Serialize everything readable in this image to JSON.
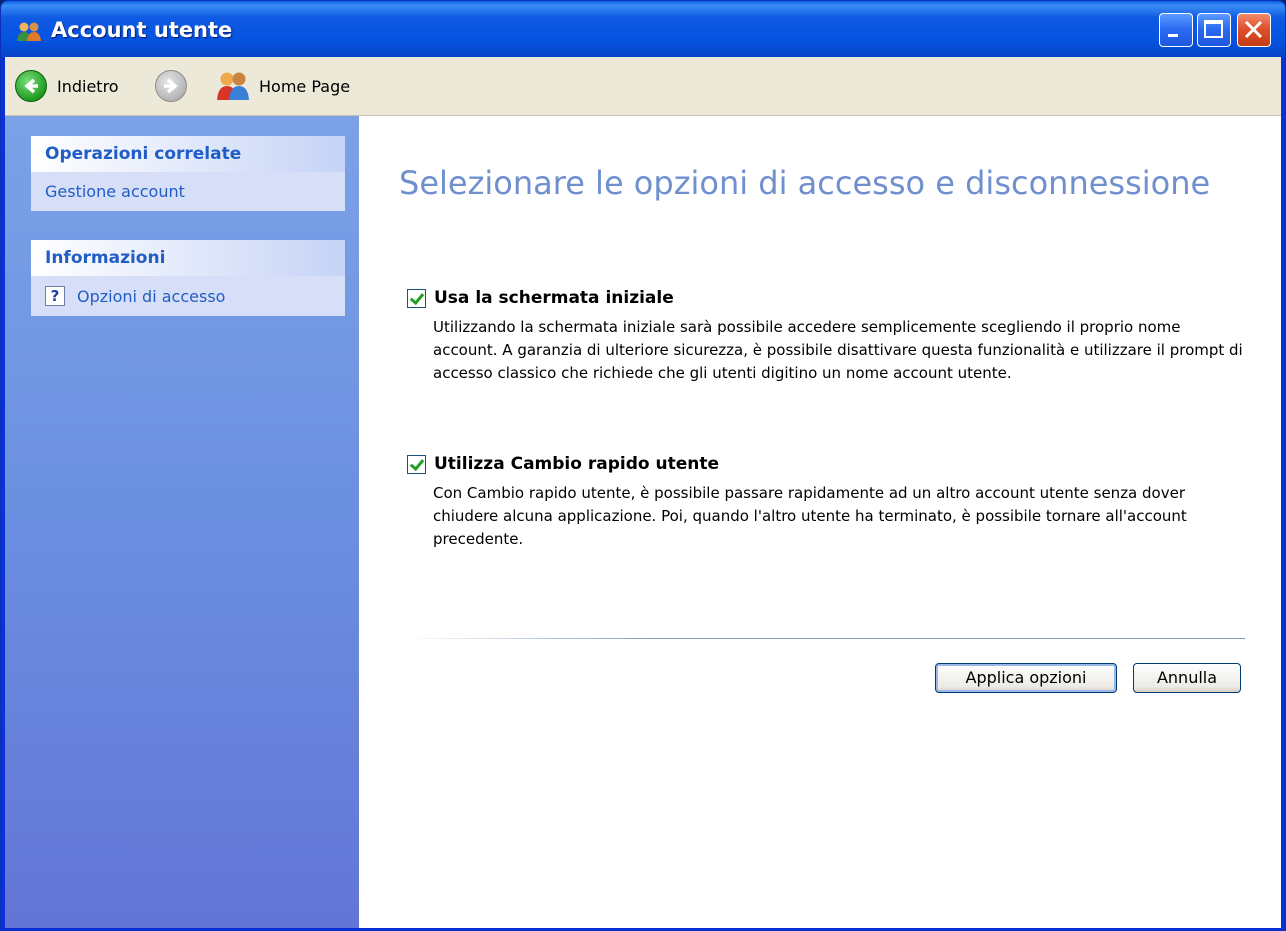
{
  "window": {
    "title": "Account utente",
    "colors": {
      "titlebar": "#0553e0",
      "sidebar": "#6b8fe0",
      "heading": "#6f8fcf",
      "link": "#215dc6"
    }
  },
  "titlebar": {
    "icons": [
      "users-icon",
      "minimize-icon",
      "maximize-icon",
      "close-icon"
    ]
  },
  "toolbar": {
    "back_label": "Indietro",
    "home_label": "Home Page"
  },
  "sidebar": {
    "panels": [
      {
        "title": "Operazioni correlate",
        "links": [
          {
            "label": "Gestione account"
          }
        ]
      },
      {
        "title": "Informazioni",
        "links": [
          {
            "label": "Opzioni di accesso",
            "icon": "help-icon"
          }
        ]
      }
    ]
  },
  "main": {
    "heading": "Selezionare le opzioni di accesso e disconnessione",
    "options": [
      {
        "label": "Usa la schermata iniziale",
        "checked": true,
        "description": "Utilizzando la schermata iniziale sarà possibile accedere semplicemente scegliendo il proprio nome account. A garanzia di ulteriore sicurezza, è possibile disattivare questa funzionalità e utilizzare il prompt di accesso classico che richiede che gli utenti digitino un nome account utente."
      },
      {
        "label": "Utilizza Cambio rapido utente",
        "checked": true,
        "description": "Con Cambio rapido utente, è possibile passare rapidamente ad un altro account utente senza dover chiudere alcuna applicazione. Poi, quando l'altro utente ha terminato, è possibile tornare all'account precedente."
      }
    ],
    "apply_label": "Applica opzioni",
    "cancel_label": "Annulla"
  }
}
